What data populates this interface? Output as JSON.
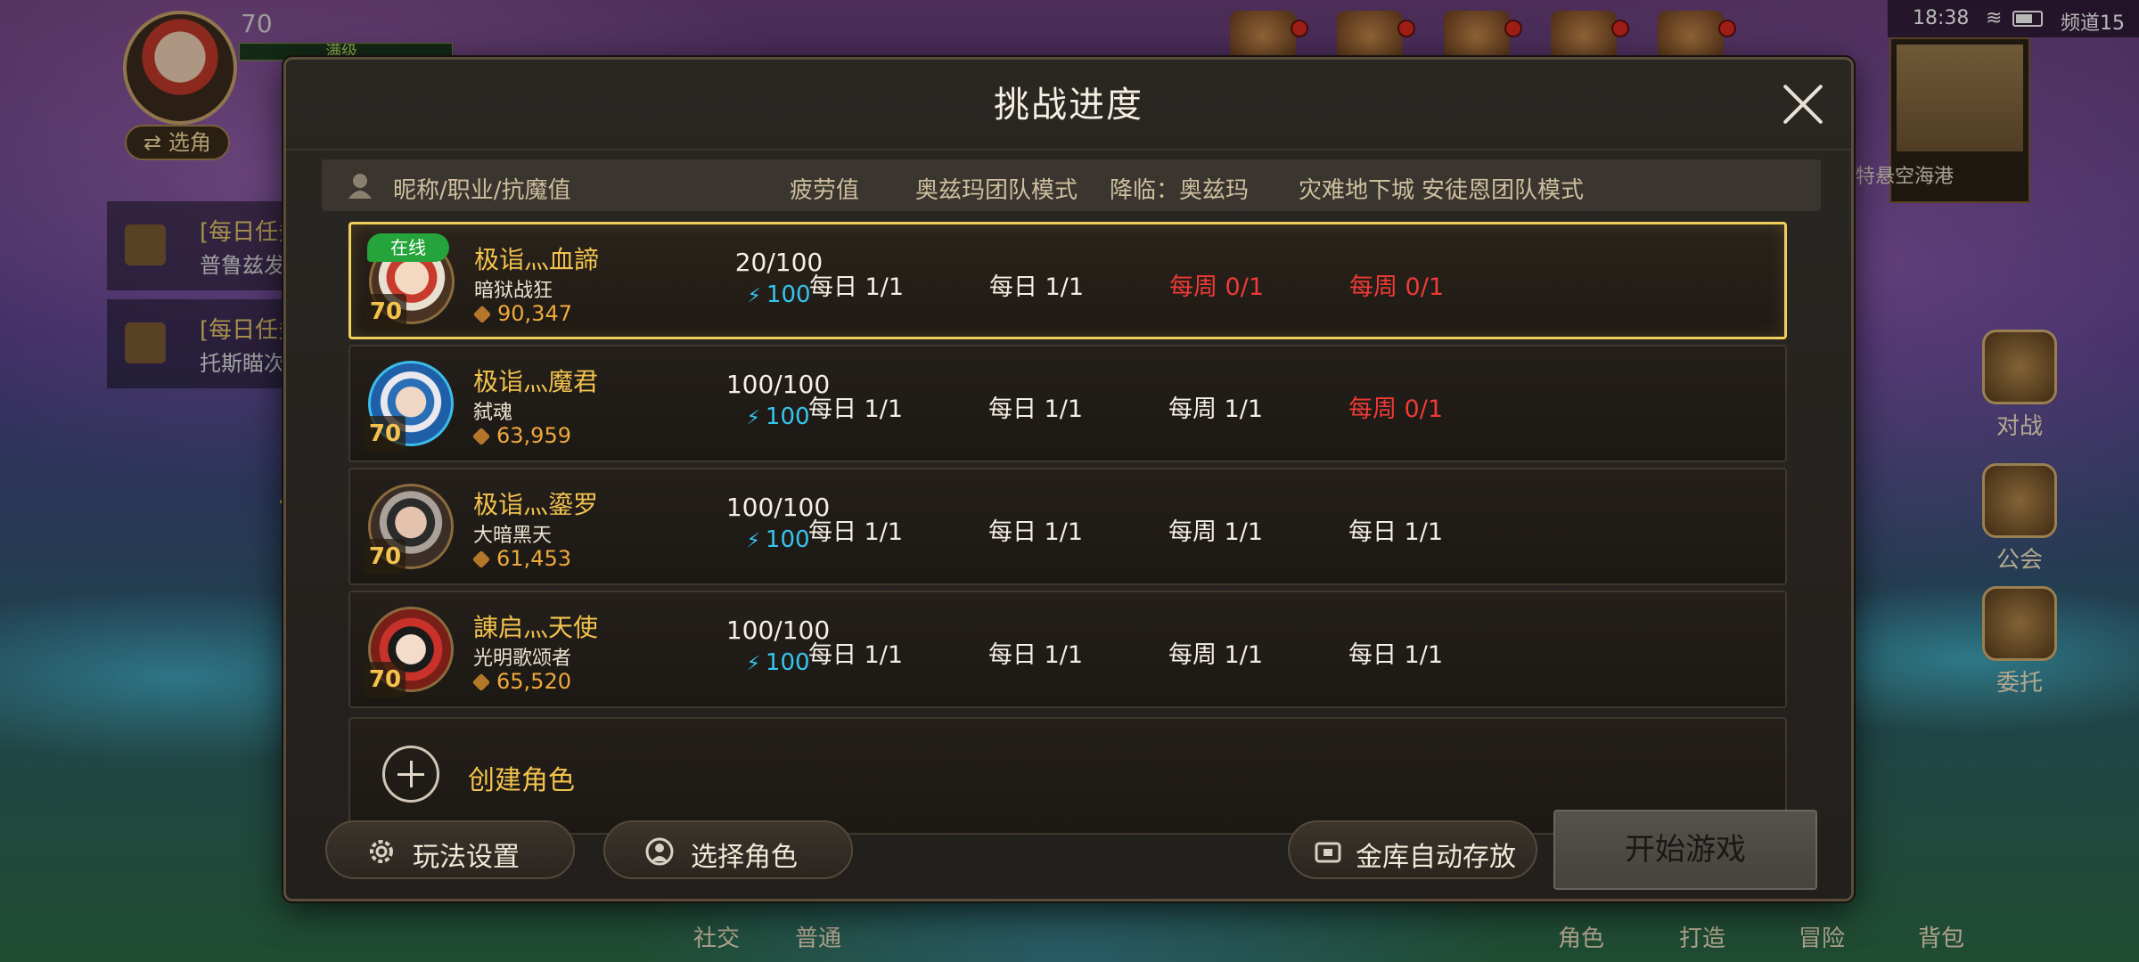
{
  "hud": {
    "level": "70",
    "bar_label": "满级",
    "switch_char": "⇄ 选角",
    "tasks": [
      {
        "title": "[每日任务]",
        "desc": "普鲁兹发..."
      },
      {
        "title": "[每日任务]",
        "desc": "托斯瞄次..."
      }
    ],
    "status": {
      "time": "18:38",
      "channel": "频道15"
    },
    "minimap_location": "特悬空海港",
    "side_buttons": [
      "对战",
      "公会",
      "委托"
    ],
    "bottom_tabs": [
      "社交",
      "普通",
      "角色",
      "打造",
      "冒险",
      "背包"
    ]
  },
  "modal": {
    "title": "挑战进度",
    "columns": [
      "昵称/职业/抗魔值",
      "疲劳值",
      "奥兹玛团队模式",
      "降临：奥兹玛",
      "灾难地下城",
      "安徒恩团队模式"
    ],
    "characters": [
      {
        "online_tag": "在线",
        "level": "70",
        "nickname": "极诣灬血諦",
        "job": "暗狱战狂",
        "power": "90,347",
        "fatigue": "20/100",
        "fatigue_sub": "100",
        "cells": [
          {
            "text": "每日 1/1",
            "red": false
          },
          {
            "text": "每日 1/1",
            "red": false
          },
          {
            "text": "每周 0/1",
            "red": true
          },
          {
            "text": "每周 0/1",
            "red": true
          }
        ]
      },
      {
        "online_tag": "",
        "level": "70",
        "nickname": "极诣灬魔君",
        "job": "弑魂",
        "power": "63,959",
        "fatigue": "100/100",
        "fatigue_sub": "100",
        "cells": [
          {
            "text": "每日 1/1",
            "red": false
          },
          {
            "text": "每日 1/1",
            "red": false
          },
          {
            "text": "每周 1/1",
            "red": false
          },
          {
            "text": "每周 0/1",
            "red": true
          }
        ]
      },
      {
        "online_tag": "",
        "level": "70",
        "nickname": "极诣灬鎏罗",
        "job": "大暗黑天",
        "power": "61,453",
        "fatigue": "100/100",
        "fatigue_sub": "100",
        "cells": [
          {
            "text": "每日 1/1",
            "red": false
          },
          {
            "text": "每日 1/1",
            "red": false
          },
          {
            "text": "每周 1/1",
            "red": false
          },
          {
            "text": "每日 1/1",
            "red": false
          }
        ]
      },
      {
        "online_tag": "",
        "level": "70",
        "nickname": "諌启灬天使",
        "job": "光明歌颂者",
        "power": "65,520",
        "fatigue": "100/100",
        "fatigue_sub": "100",
        "cells": [
          {
            "text": "每日 1/1",
            "red": false
          },
          {
            "text": "每日 1/1",
            "red": false
          },
          {
            "text": "每周 1/1",
            "red": false
          },
          {
            "text": "每日 1/1",
            "red": false
          }
        ]
      }
    ],
    "create_label": "创建角色",
    "buttons": {
      "settings": "玩法设置",
      "select_char": "选择角色",
      "auto_store": "金库自动存放",
      "start": "开始游戏"
    }
  },
  "colors": {
    "accent_gold": "#f3c34e",
    "status_red": "#f03a36",
    "fatigue_blue": "#35c5f0",
    "online_green": "#24a43a",
    "selected_border": "#f0cf5a"
  }
}
